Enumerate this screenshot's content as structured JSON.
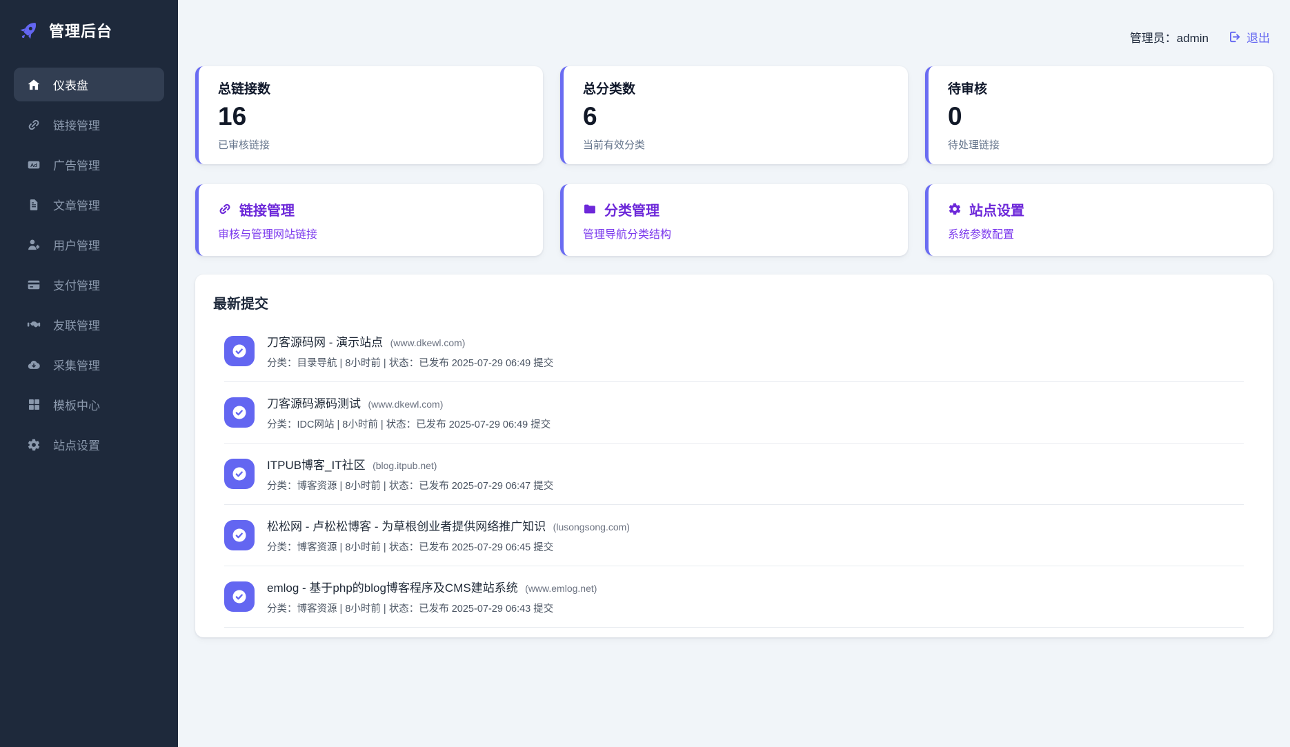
{
  "app": {
    "brand": "管理后台"
  },
  "header": {
    "admin_text": "管理员：admin",
    "logout_label": "退出"
  },
  "sidebar": {
    "items": [
      {
        "label": "仪表盘",
        "icon": "home-icon",
        "active": true
      },
      {
        "label": "链接管理",
        "icon": "link-icon",
        "active": false
      },
      {
        "label": "广告管理",
        "icon": "ad-icon",
        "active": false
      },
      {
        "label": "文章管理",
        "icon": "file-icon",
        "active": false
      },
      {
        "label": "用户管理",
        "icon": "user-gear-icon",
        "active": false
      },
      {
        "label": "支付管理",
        "icon": "credit-card-icon",
        "active": false
      },
      {
        "label": "友联管理",
        "icon": "handshake-icon",
        "active": false
      },
      {
        "label": "采集管理",
        "icon": "cloud-download-icon",
        "active": false
      },
      {
        "label": "模板中心",
        "icon": "grid-icon",
        "active": false
      },
      {
        "label": "站点设置",
        "icon": "gear-icon",
        "active": false
      }
    ]
  },
  "stats": [
    {
      "title": "总链接数",
      "value": "16",
      "subtitle": "已审核链接"
    },
    {
      "title": "总分类数",
      "value": "6",
      "subtitle": "当前有效分类"
    },
    {
      "title": "待审核",
      "value": "0",
      "subtitle": "待处理链接"
    }
  ],
  "quick_links": [
    {
      "title": "链接管理",
      "subtitle": "审核与管理网站链接",
      "icon": "link-icon"
    },
    {
      "title": "分类管理",
      "subtitle": "管理导航分类结构",
      "icon": "folder-icon"
    },
    {
      "title": "站点设置",
      "subtitle": "系统参数配置",
      "icon": "gear-icon"
    }
  ],
  "recent": {
    "title": "最新提交",
    "items": [
      {
        "title": "刀客源码网 - 演示站点",
        "domain": "(www.dkewl.com)",
        "meta": "分类：目录导航 | 8小时前 | 状态：已发布 2025-07-29 06:49 提交"
      },
      {
        "title": "刀客源码源码测试",
        "domain": "(www.dkewl.com)",
        "meta": "分类：IDC网站 | 8小时前 | 状态：已发布 2025-07-29 06:49 提交"
      },
      {
        "title": "ITPUB博客_IT社区",
        "domain": "(blog.itpub.net)",
        "meta": "分类：博客资源 | 8小时前 | 状态：已发布 2025-07-29 06:47 提交"
      },
      {
        "title": "松松网 - 卢松松博客 - 为草根创业者提供网络推广知识",
        "domain": "(lusongsong.com)",
        "meta": "分类：博客资源 | 8小时前 | 状态：已发布 2025-07-29 06:45 提交"
      },
      {
        "title": "emlog - 基于php的blog博客程序及CMS建站系统",
        "domain": "(www.emlog.net)",
        "meta": "分类：博客资源 | 8小时前 | 状态：已发布 2025-07-29 06:43 提交"
      }
    ]
  },
  "colors": {
    "accent": "#6366f1",
    "sidebar_bg": "#1e293b",
    "page_bg": "#f1f5f9",
    "quick_title": "#6d28d9",
    "quick_subtitle": "#7c3aed"
  }
}
